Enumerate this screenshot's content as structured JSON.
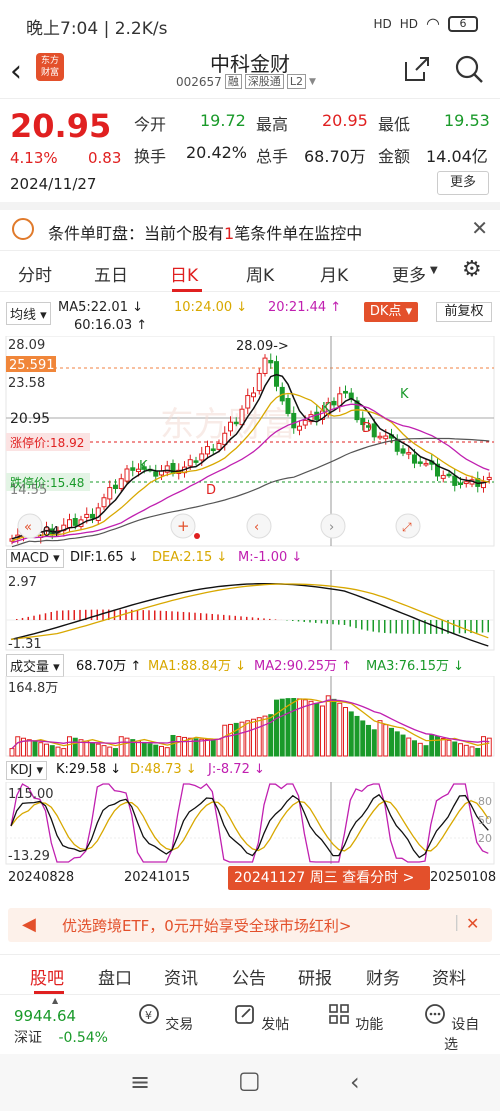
{
  "status": {
    "time_speed": "晚上7:04 | 2.2K/s",
    "battery": "6",
    "signal1": "HD",
    "signal2": "HD"
  },
  "header": {
    "title": "中科金财",
    "code": "002657",
    "tag1": "融",
    "tag2": "深股通",
    "tag3": "L2",
    "logo": "东方\n财富"
  },
  "quote": {
    "price": "20.95",
    "pct": "4.13%",
    "change": "0.83",
    "date": "2024/11/27",
    "open_label": "今开",
    "open": "19.72",
    "high_label": "最高",
    "high": "20.95",
    "low_label": "最低",
    "low": "19.53",
    "turnover_label": "换手",
    "turnover": "20.42%",
    "volume_label": "总手",
    "volume": "68.70万",
    "amount_label": "金额",
    "amount": "14.04亿",
    "more": "更多"
  },
  "alert": {
    "prefix": "条件单盯盘：当前个股有",
    "count": "1",
    "suffix": "笔条件单在监控中"
  },
  "tabs": [
    "分时",
    "五日",
    "日K",
    "周K",
    "月K",
    "更多"
  ],
  "ma": {
    "selector": "均线",
    "ma5": "MA5:22.01 ↓",
    "ma10": "10:24.00 ↓",
    "ma20": "20:21.44 ↑",
    "ma60": "60:16.03 ↑",
    "dk": "DK点",
    "fq": "前复权"
  },
  "kchart": {
    "y_top": "28.09",
    "y_mark": "25.591",
    "y_2358": "23.58",
    "y_price": "20.95",
    "limit_up": "涨停价:18.92",
    "limit_down": "跌停价:15.48",
    "y_1455": "14.55",
    "y_low": "10.04",
    "peak_label": "28.09->",
    "d_label": "D",
    "k_label": "K",
    "watermark": "东方财富"
  },
  "macd": {
    "selector": "MACD",
    "dif": "DIF:1.65 ↓",
    "dea": "DEA:2.15 ↓",
    "m": "M:-1.00 ↓",
    "y_top": "2.97",
    "y_bottom": "-1.31"
  },
  "vol": {
    "selector": "成交量",
    "vol": "68.70万 ↑",
    "ma1": "MA1:88.84万 ↓",
    "ma2": "MA2:90.25万 ↑",
    "ma3": "MA3:76.15万 ↓",
    "y_top": "164.8万"
  },
  "kdj": {
    "selector": "KDJ",
    "k": "K:29.58 ↓",
    "d": "D:48.73 ↓",
    "j": "J:-8.72 ↓",
    "y_top": "115.00",
    "y_bottom": "-13.29",
    "r80": "80",
    "r50": "50",
    "r20": "20"
  },
  "xaxis": {
    "d1": "20240828",
    "d2": "20241015",
    "d3": "20250108",
    "cursor": "20241127 周三  查看分时 >"
  },
  "promo": {
    "text": "优选跨境ETF，0元开始享受全球市场红利>"
  },
  "bottom_tabs": [
    "股吧",
    "盘口",
    "资讯",
    "公告",
    "研报",
    "财务",
    "资料"
  ],
  "toolbar": {
    "index_value": "9944.64",
    "index_name": "深证",
    "index_pct": "-0.54%",
    "trade": "交易",
    "post": "发帖",
    "func": "功能",
    "watch": "设自选"
  },
  "colors": {
    "up": "#e02020",
    "down": "#1a9a2a",
    "accent": "#e3502b"
  }
}
